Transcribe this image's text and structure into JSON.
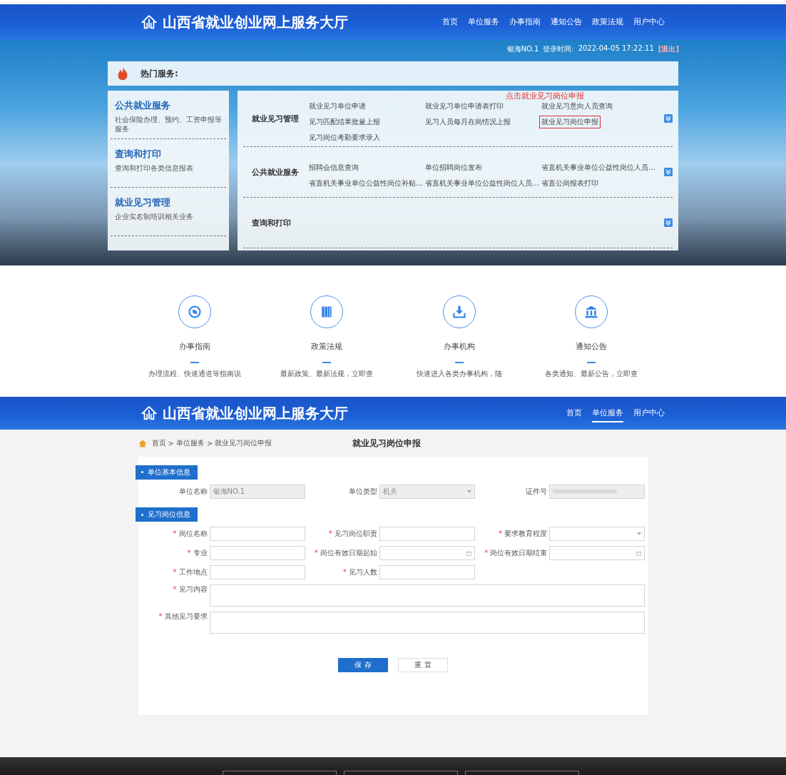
{
  "top_header": {
    "site_title": "山西省就业创业网上服务大厅",
    "nav": [
      {
        "label": "首页",
        "selected": false
      },
      {
        "label": "单位服务",
        "selected": false
      },
      {
        "label": "办事指南",
        "selected": false
      },
      {
        "label": "通知公告",
        "selected": false
      },
      {
        "label": "政策法规",
        "selected": false
      },
      {
        "label": "用户中心",
        "selected": false
      }
    ]
  },
  "user_bar": {
    "user": "银海NO.1",
    "login_label": "登录时间:",
    "login_time": "2022-04-05 17:22:11",
    "logout": "[退出]"
  },
  "hot_services": {
    "title": "热门服务:",
    "categories": [
      {
        "title": "公共就业服务",
        "description": "社会保险办理、预约、工资申报等服务"
      },
      {
        "title": "查询和打印",
        "description": "查询和打印各类信息报表"
      },
      {
        "title": "就业见习管理",
        "description": "企业实名制培训相关业务"
      }
    ],
    "annotation": "点击就业见习岗位申报",
    "groups": [
      {
        "title": "就业见习管理",
        "links": [
          {
            "label": "就业见习单位申请",
            "highlighted": false
          },
          {
            "label": "就业见习单位申请表打印",
            "highlighted": false
          },
          {
            "label": "就业见习意向人员查询",
            "highlighted": false
          },
          {
            "label": "见习匹配结果批量上报",
            "highlighted": false
          },
          {
            "label": "见习人员每月在岗情况上报",
            "highlighted": false
          },
          {
            "label": "就业见习岗位申报",
            "highlighted": true
          },
          {
            "label": "见习岗位考勤要求录入",
            "highlighted": false
          }
        ]
      },
      {
        "title": "公共就业服务",
        "links": [
          {
            "label": "招聘会信息查询",
            "highlighted": false
          },
          {
            "label": "单位招聘岗位发布",
            "highlighted": false
          },
          {
            "label": "省直机关事业单位公益性岗位人员…",
            "highlighted": false
          },
          {
            "label": "省直机关事业单位公益性岗位补贴…",
            "highlighted": false
          },
          {
            "label": "省直机关事业单位公益性岗位人员…",
            "highlighted": false
          },
          {
            "label": "省直公岗报表打印",
            "highlighted": false
          }
        ]
      },
      {
        "title": "查询和打印"
      }
    ]
  },
  "quick_links": [
    {
      "kind": "compass",
      "label": "办事指南",
      "description": "办理流程、快速通道等指南说"
    },
    {
      "kind": "books",
      "label": "政策法规",
      "description": "最新政策、最新法规，立即查"
    },
    {
      "kind": "download",
      "label": "办事机构",
      "description": "快速进入各类办事机构，随"
    },
    {
      "kind": "bank",
      "label": "通知公告",
      "description": "各类通知、最新公告，立即查"
    }
  ],
  "form_header": {
    "site_title": "山西省就业创业网上服务大厅",
    "nav": [
      {
        "label": "首页",
        "selected": false
      },
      {
        "label": "单位服务",
        "selected": true
      },
      {
        "label": "用户中心",
        "selected": false
      }
    ]
  },
  "breadcrumb": [
    "首页",
    ">",
    "单位服务",
    ">",
    "就业见习岗位申报"
  ],
  "page_title": "就业见习岗位申报",
  "required_mark": "*",
  "sections": [
    {
      "title": "单位基本信息",
      "fields": [
        {
          "label": "单位名称",
          "kind": "text",
          "value": "银海NO.1",
          "disabled": true,
          "required": false
        },
        {
          "label": "单位类型",
          "kind": "select",
          "value": "机关",
          "disabled": true,
          "required": false
        },
        {
          "label": "证件号",
          "kind": "redacted",
          "disabled": true,
          "required": false
        }
      ]
    },
    {
      "title": "见习岗位信息",
      "fields": [
        {
          "label": "岗位名称",
          "kind": "text",
          "disabled": false,
          "required": true
        },
        {
          "label": "见习岗位职责",
          "kind": "text",
          "disabled": false,
          "required": true
        },
        {
          "label": "要求教育程度",
          "kind": "select",
          "disabled": false,
          "required": true
        },
        {
          "label": "专业",
          "kind": "text",
          "disabled": false,
          "required": true
        },
        {
          "label": "岗位有效日期起始",
          "kind": "date",
          "disabled": false,
          "required": true
        },
        {
          "label": "岗位有效日期结束",
          "kind": "date",
          "disabled": false,
          "required": true
        },
        {
          "label": "工作地点",
          "kind": "text",
          "disabled": false,
          "required": true
        },
        {
          "label": "见习人数",
          "kind": "text",
          "disabled": false,
          "required": true
        },
        {
          "label": "见习内容",
          "kind": "textarea",
          "disabled": false,
          "required": true
        },
        {
          "label": "其他见习要求",
          "kind": "textarea",
          "disabled": false,
          "required": true
        }
      ]
    }
  ],
  "buttons": [
    {
      "label": "保 存",
      "kind": "primary"
    },
    {
      "label": "重 置",
      "kind": "secondary"
    }
  ]
}
